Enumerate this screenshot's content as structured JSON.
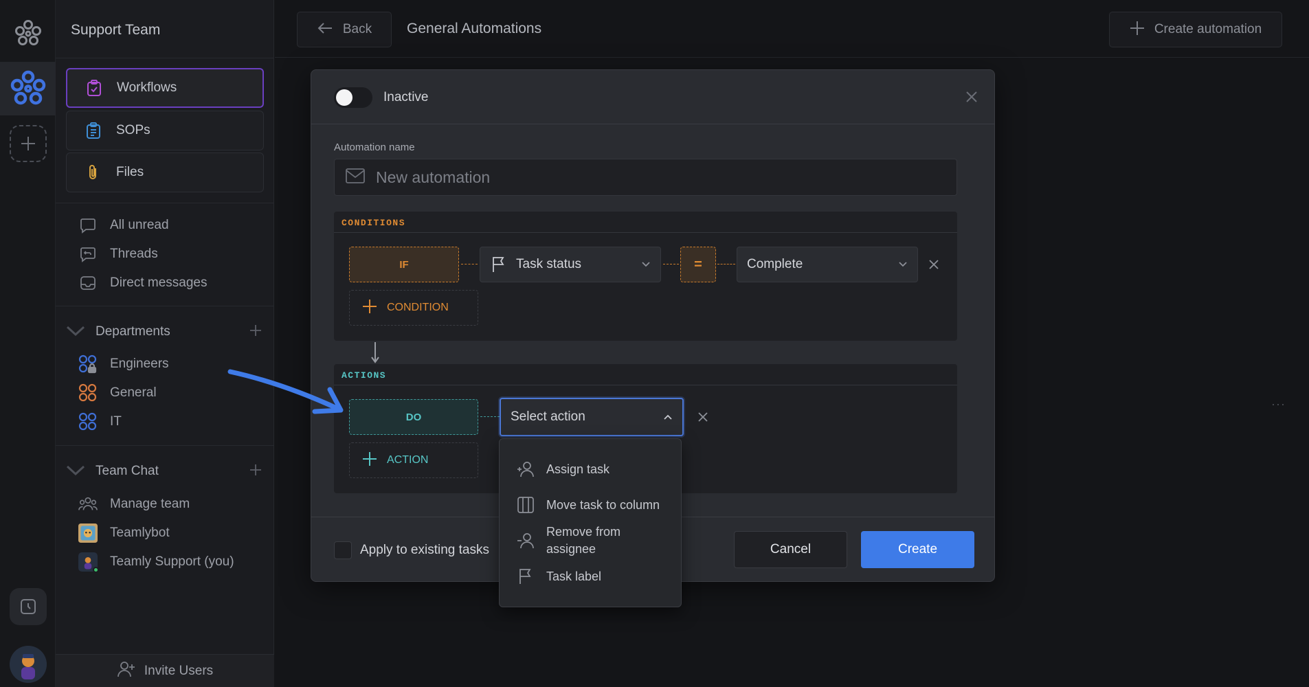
{
  "workspace": {
    "name": "Support Team"
  },
  "sidebar": {
    "nav": [
      {
        "label": "Workflows",
        "icon": "clipboard-check-icon",
        "active": true
      },
      {
        "label": "SOPs",
        "icon": "list-clipboard-icon",
        "active": false
      },
      {
        "label": "Files",
        "icon": "paperclip-icon",
        "active": false
      }
    ],
    "inbox": [
      {
        "label": "All unread",
        "icon": "chat-bubble-icon"
      },
      {
        "label": "Threads",
        "icon": "reply-bubble-icon"
      },
      {
        "label": "Direct messages",
        "icon": "inbox-icon"
      }
    ],
    "departments": {
      "title": "Departments",
      "items": [
        {
          "label": "Engineers",
          "icon": "grid-lock-icon"
        },
        {
          "label": "General",
          "icon": "grid-circles-icon"
        },
        {
          "label": "IT",
          "icon": "grid-circles-icon"
        }
      ]
    },
    "team_chat": {
      "title": "Team Chat",
      "items": [
        {
          "label": "Manage team",
          "icon": "team-icon"
        },
        {
          "label": "Teamlybot",
          "icon": "bot-avatar"
        },
        {
          "label": "Teamly Support (you)",
          "icon": "user-avatar"
        }
      ]
    },
    "invite": "Invite Users"
  },
  "topbar": {
    "back": "Back",
    "title": "General Automations",
    "create": "Create automation"
  },
  "modal": {
    "toggle_label": "Inactive",
    "name_label": "Automation name",
    "name_placeholder": "New automation",
    "conditions": {
      "title": "CONDITIONS",
      "if_label": "IF",
      "field": "Task status",
      "operator": "=",
      "value": "Complete",
      "add_label": "CONDITION"
    },
    "actions": {
      "title": "ACTIONS",
      "do_label": "DO",
      "select_label": "Select action",
      "add_label": "ACTION"
    },
    "apply_label": "Apply to existing tasks",
    "cancel": "Cancel",
    "create": "Create"
  },
  "dropdown": {
    "items": [
      {
        "label": "Assign task",
        "icon": "assign-user-icon"
      },
      {
        "label": "Move task to column",
        "icon": "columns-icon"
      },
      {
        "label": "Remove from assignee",
        "icon": "remove-user-icon"
      },
      {
        "label": "Task label",
        "icon": "flag-icon"
      }
    ]
  },
  "colors": {
    "accent": "#3e7be8",
    "condition": "#e08b33",
    "action": "#57c6c6",
    "active_nav_border": "#6a3fc0"
  }
}
